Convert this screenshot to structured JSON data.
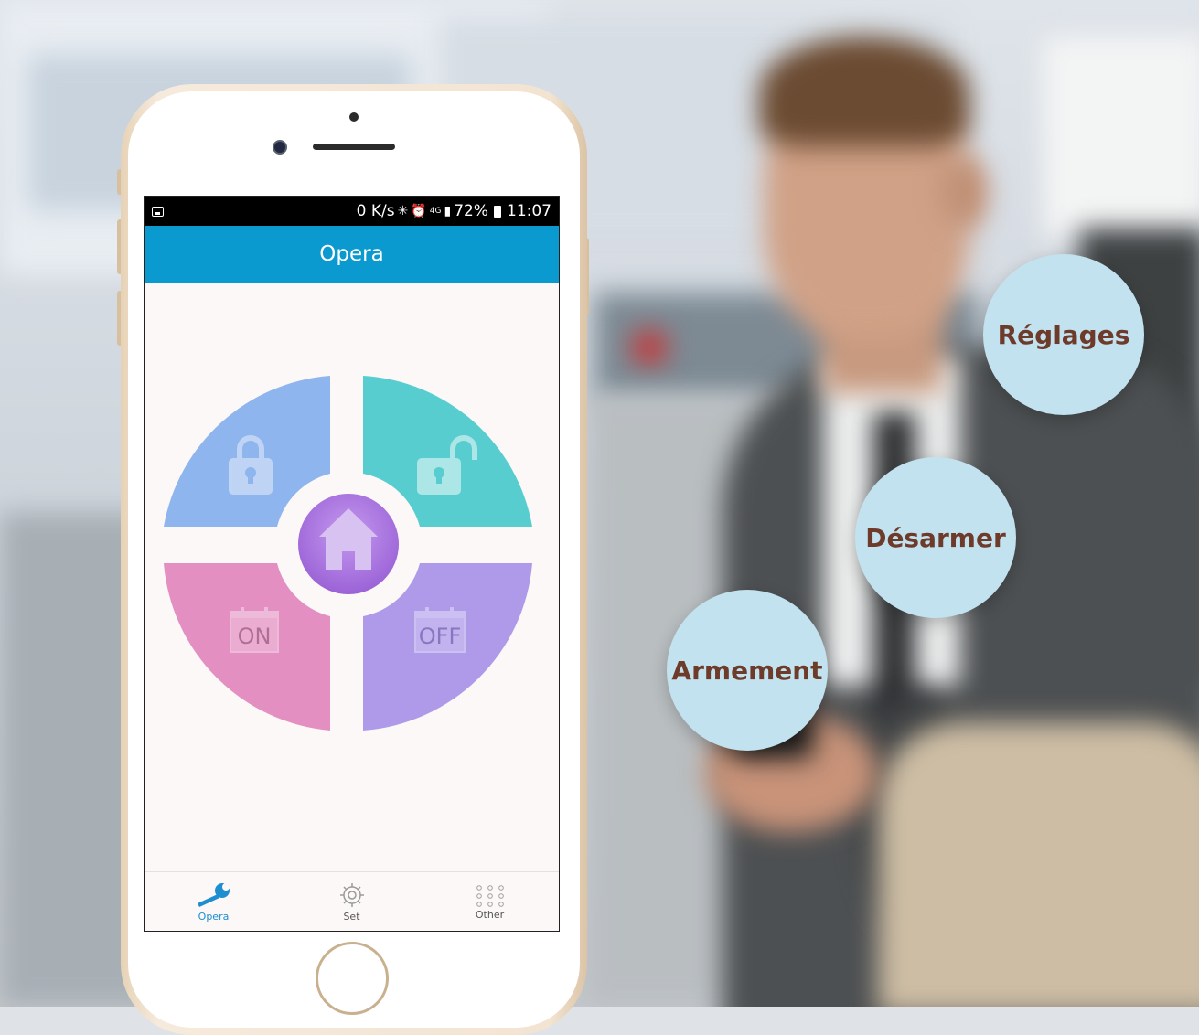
{
  "status_bar": {
    "speed": "0 K/s",
    "network_badge": "4G",
    "battery": "72%",
    "time": "11:07"
  },
  "app": {
    "title": "Opera",
    "accent_color": "#0a9ad0"
  },
  "controls": {
    "on_label": "ON",
    "off_label": "OFF",
    "colors": {
      "arm": "#8eb5ee",
      "disarm": "#58cdcf",
      "on": "#e38fc1",
      "off": "#ae9ae9",
      "home": "#b47fe0"
    }
  },
  "bottom_nav": {
    "items": [
      {
        "label": "Opera",
        "icon": "wrench-icon",
        "active": true
      },
      {
        "label": "Set",
        "icon": "gear-icon",
        "active": false
      },
      {
        "label": "Other",
        "icon": "dots-grid-icon",
        "active": false
      }
    ]
  },
  "features": {
    "reglages": "Réglages",
    "desarmer": "Désarmer",
    "armement": "Armement"
  }
}
